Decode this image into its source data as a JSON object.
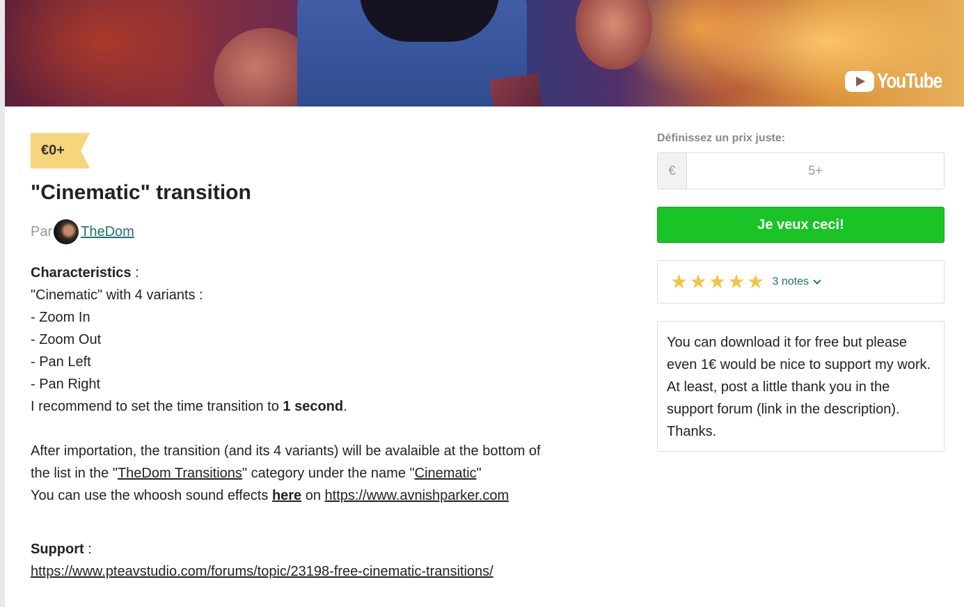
{
  "banner": {
    "brand": "YouTube",
    "icon": "youtube-play-icon"
  },
  "product": {
    "price_tag": "€0+",
    "title": "\"Cinematic\" transition",
    "by_label": "Par",
    "author": "TheDom"
  },
  "description": {
    "characteristics_label": "Characteristics",
    "characteristics_colon": " :",
    "variants_intro": "\"Cinematic\" with 4 variants :",
    "variants": [
      "- Zoom In",
      "- Zoom Out",
      "- Pan Left",
      "- Pan Right"
    ],
    "recommend_text": "I recommend to set the time transition to ",
    "recommend_bold": "1 second",
    "recommend_end": ".",
    "import_line1": "After importation, the transition (and its 4 variants) will be avalaible at the bottom of",
    "import_line2_a": "the list in the \"",
    "import_link_category": "TheDom Transitions",
    "import_line2_b": "\" category under the name \"",
    "import_link_name": "Cinematic",
    "import_line2_c": "\"",
    "whoosh_text": "You can use the whoosh sound effects ",
    "whoosh_link": "here",
    "whoosh_on": " on ",
    "whoosh_url": "https://www.avnishparker.com",
    "support_label": "Support",
    "support_colon": " :",
    "support_url": "https://www.pteavstudio.com/forums/topic/23198-free-cinematic-transitions/"
  },
  "purchase": {
    "price_label": "Définissez un prix juste:",
    "currency": "€",
    "price_placeholder": "5+",
    "buy_label": "Je veux ceci!",
    "ratings_count": "3 notes",
    "rating_value": 5,
    "seller_note": "You can download it for free but please even 1€ would be nice to support my work. At least, post a little thank you in the support forum (link in the description). Thanks."
  },
  "colors": {
    "buy_green": "#1ac426",
    "price_tag": "#f6d57d",
    "link_teal": "#1f6f74",
    "star": "#f6c348"
  }
}
